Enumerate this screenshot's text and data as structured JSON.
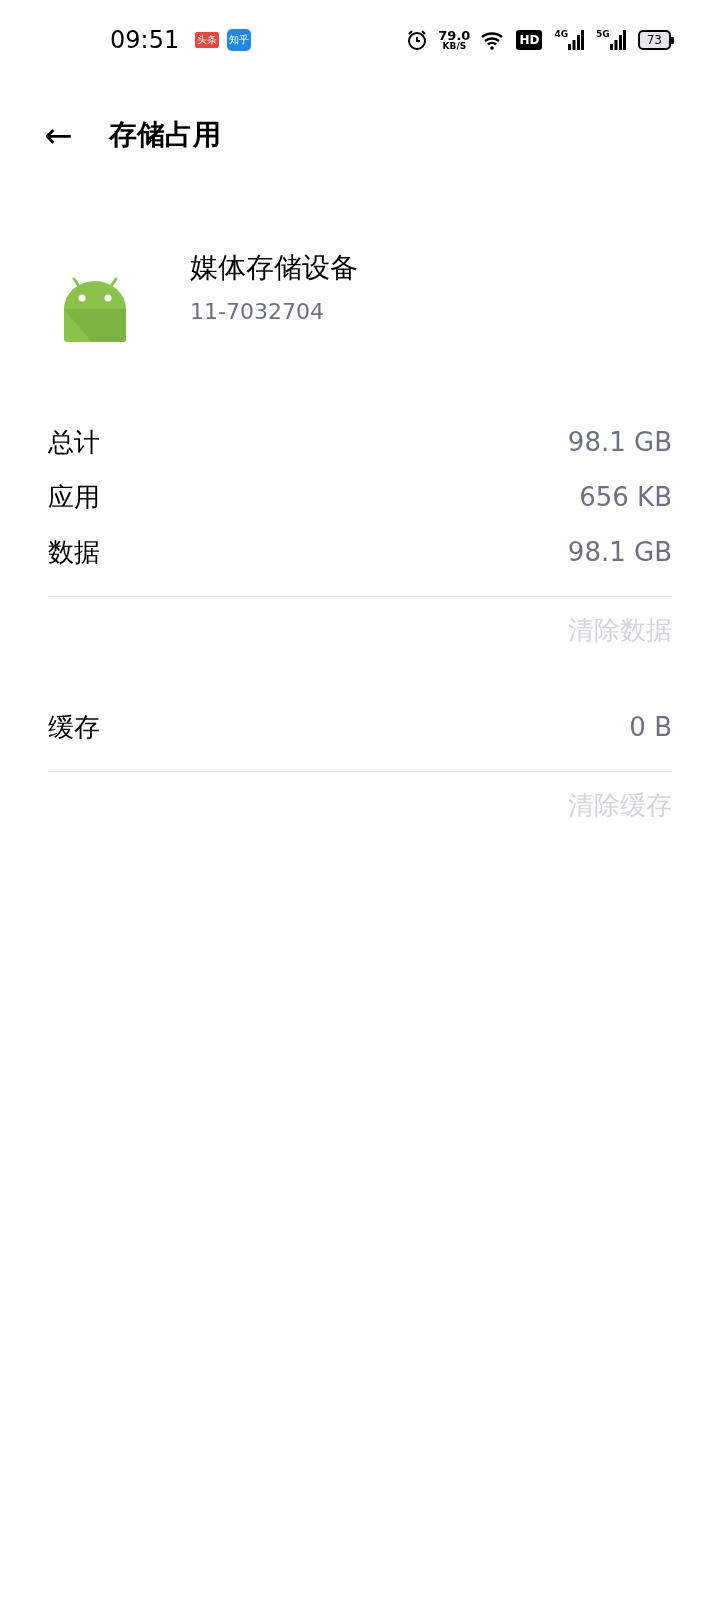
{
  "status_bar": {
    "time": "09:51",
    "notifications": [
      {
        "label": "头条",
        "color": "#e8453c"
      },
      {
        "label": "知乎",
        "color": "#1e88e5"
      }
    ],
    "speed": "79.0",
    "speed_unit": "KB/S",
    "hd": "HD",
    "network_labels": [
      "4G",
      "5G"
    ],
    "battery": "73"
  },
  "header": {
    "back": "←",
    "title": "存储占用"
  },
  "app": {
    "name": "媒体存储设备",
    "version": "11-7032704"
  },
  "sections": [
    {
      "rows": [
        {
          "label": "总计",
          "value": "98.1 GB"
        },
        {
          "label": "应用",
          "value": "656 KB"
        },
        {
          "label": "数据",
          "value": "98.1 GB"
        }
      ],
      "action": {
        "label": "清除数据",
        "disabled": true
      }
    },
    {
      "rows": [
        {
          "label": "缓存",
          "value": "0 B"
        }
      ],
      "action": {
        "label": "清除缓存",
        "disabled": true
      }
    }
  ]
}
